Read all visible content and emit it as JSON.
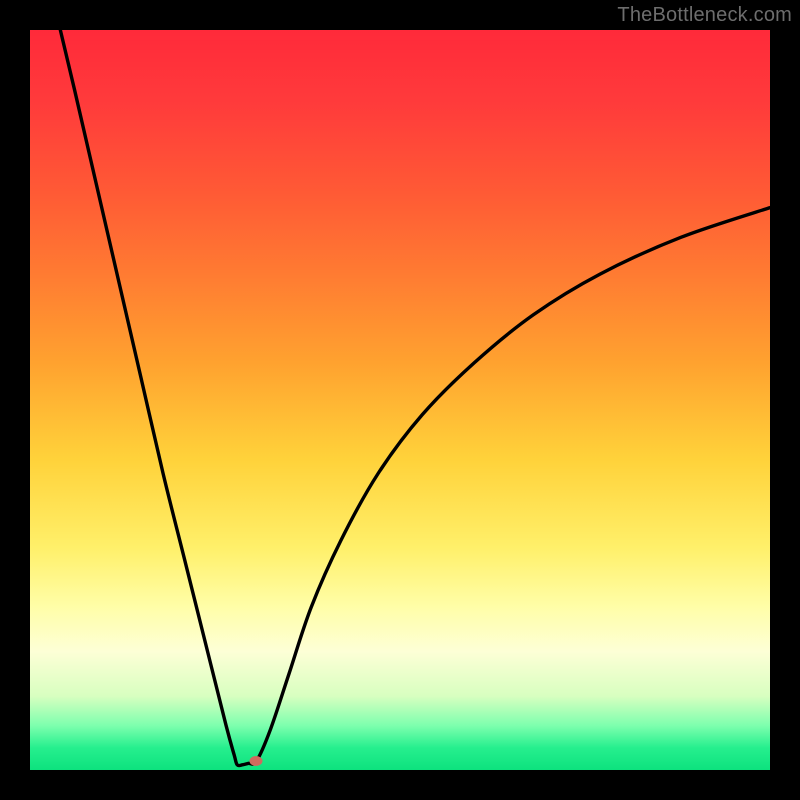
{
  "watermark": "TheBottleneck.com",
  "colors": {
    "gradient_top": "#ff2a3a",
    "gradient_bottom": "#0de27e",
    "curve": "#000000",
    "marker": "#d06a5e",
    "frame_bg": "#000000"
  },
  "chart_data": {
    "type": "line",
    "title": "",
    "xlabel": "",
    "ylabel": "",
    "xlim": [
      0,
      100
    ],
    "ylim": [
      0,
      100
    ],
    "grid": false,
    "legend": false,
    "curve_points_percent": [
      {
        "x": 4.1,
        "y": 100.0
      },
      {
        "x": 6.0,
        "y": 92.0
      },
      {
        "x": 9.0,
        "y": 79.0
      },
      {
        "x": 12.0,
        "y": 66.0
      },
      {
        "x": 15.0,
        "y": 53.0
      },
      {
        "x": 18.0,
        "y": 40.0
      },
      {
        "x": 21.0,
        "y": 28.0
      },
      {
        "x": 24.0,
        "y": 16.0
      },
      {
        "x": 26.5,
        "y": 6.0
      },
      {
        "x": 27.6,
        "y": 2.0
      },
      {
        "x": 28.0,
        "y": 0.7
      },
      {
        "x": 28.7,
        "y": 0.7
      },
      {
        "x": 29.5,
        "y": 0.9
      },
      {
        "x": 30.6,
        "y": 1.2
      },
      {
        "x": 32.5,
        "y": 5.5
      },
      {
        "x": 35.0,
        "y": 13.0
      },
      {
        "x": 38.0,
        "y": 22.0
      },
      {
        "x": 42.0,
        "y": 31.0
      },
      {
        "x": 47.0,
        "y": 40.0
      },
      {
        "x": 53.0,
        "y": 48.0
      },
      {
        "x": 60.0,
        "y": 55.0
      },
      {
        "x": 68.0,
        "y": 61.5
      },
      {
        "x": 77.0,
        "y": 67.0
      },
      {
        "x": 88.0,
        "y": 72.0
      },
      {
        "x": 100.0,
        "y": 76.0
      }
    ],
    "minimum_marker_percent": {
      "x": 30.6,
      "y": 1.2
    }
  }
}
